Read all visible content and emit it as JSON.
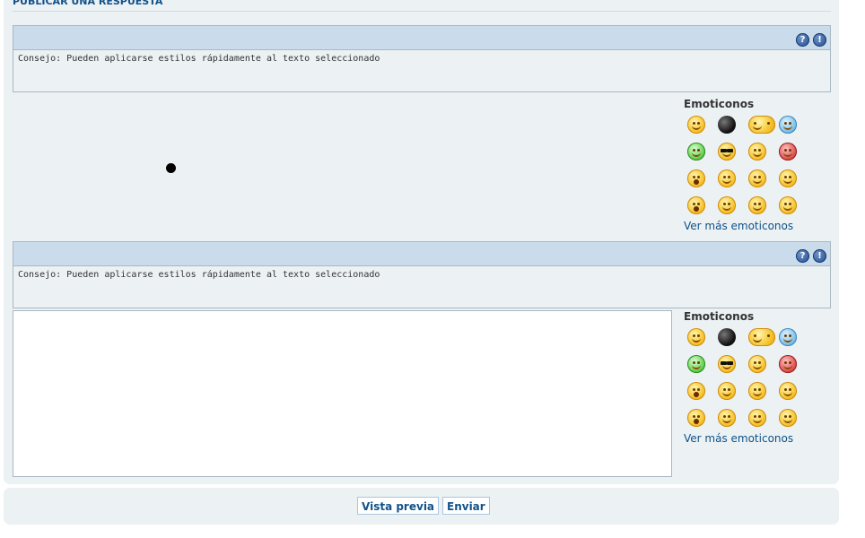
{
  "section_title": "Publicar una respuesta",
  "editors": [
    {
      "hint": "Consejo: Pueden aplicarse estilos rápidamente al texto seleccionado",
      "icons": [
        "help-icon",
        "info-icon"
      ],
      "help_glyph": "?",
      "info_glyph": "!",
      "smilies_title": "Emoticonos",
      "smilies_more": "Ver más emoticonos"
    },
    {
      "hint": "Consejo: Pueden aplicarse estilos rápidamente al texto seleccionado",
      "icons": [
        "help-icon",
        "info-icon"
      ],
      "help_glyph": "?",
      "info_glyph": "!",
      "smilies_title": "Emoticonos",
      "smilies_more": "Ver más emoticonos"
    }
  ],
  "smilies": [
    "grin-smiley-icon",
    "bomb-smiley-icon",
    "sleep-smiley-icon",
    "cold-smiley-icon",
    "sick-smiley-icon",
    "cool-smiley-icon",
    "angry-smiley-icon",
    "devil-smiley-icon",
    "shocked-smiley-icon",
    "worried-smiley-icon",
    "happy-smiley-icon",
    "content-smiley-icon",
    "surprised-smiley-icon",
    "wink-smiley-icon",
    "tongue-smiley-icon",
    "grumpy-smiley-icon"
  ],
  "buttons": {
    "preview": "Vista previa",
    "submit": "Enviar"
  }
}
